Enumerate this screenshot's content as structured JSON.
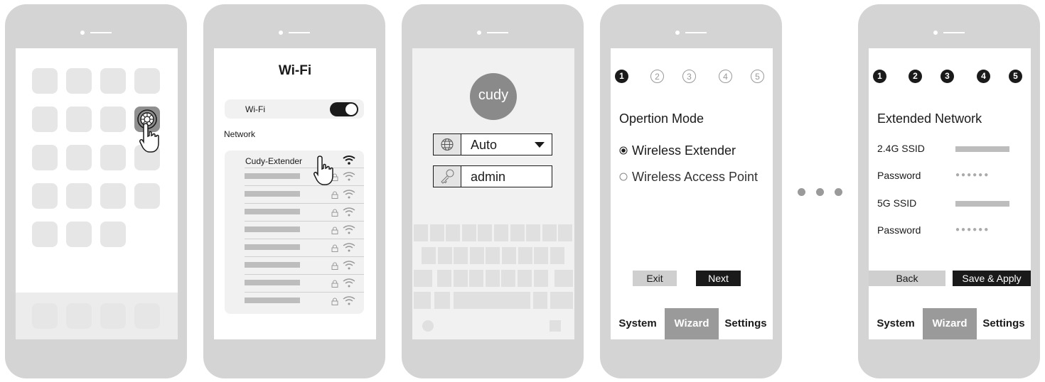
{
  "wifi_screen": {
    "title": "Wi-Fi",
    "toggle_label": "Wi-Fi",
    "network_label": "Network",
    "first_network": "Cudy-Extender"
  },
  "login_screen": {
    "logo_text": "cudy",
    "language_value": "Auto",
    "password_value": "admin"
  },
  "wizard_step1": {
    "steps": [
      "1",
      "2",
      "3",
      "4",
      "5"
    ],
    "title": "Opertion Mode",
    "option_selected": "Wireless Extender",
    "option_other": "Wireless Access Point",
    "exit_label": "Exit",
    "next_label": "Next"
  },
  "wizard_step5": {
    "steps": [
      "1",
      "2",
      "3",
      "4",
      "5"
    ],
    "title": "Extended Network",
    "ssid_24_label": "2.4G SSID",
    "password_label_1": "Password",
    "ssid_5_label": "5G SSID",
    "password_label_2": "Password",
    "password_mask": "●●●●●●",
    "back_label": "Back",
    "save_label": "Save & Apply"
  },
  "tabs": [
    "System",
    "Wizard",
    "Settings"
  ],
  "colors": {
    "phone": "#d4d4d4",
    "dark": "#1a1a1a",
    "active_tab": "#9a9a9a",
    "button_gray": "#cfcfcf"
  }
}
